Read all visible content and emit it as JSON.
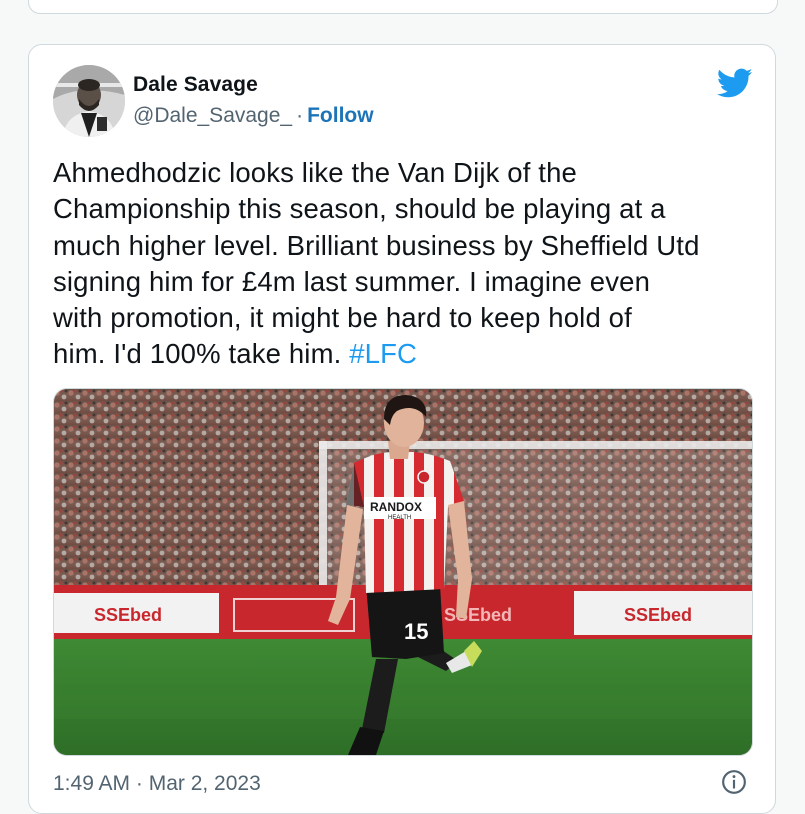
{
  "tweet": {
    "author_name": "Dale Savage",
    "handle": "@Dale_Savage_",
    "separator": "·",
    "follow_label": "Follow",
    "text_lines": [
      "Ahmedhodzic looks like the Van Dijk of the",
      "Championship this season, should be playing at a",
      "much higher level. Brilliant business by Sheffield Utd",
      "signing him for £4m last summer. I imagine even",
      "with promotion, it might be hard to keep hold of",
      "him. I'd 100% take him. "
    ],
    "hashtag": "#LFC",
    "timestamp": "1:49 AM · Mar 2, 2023",
    "photo": {
      "kit_sponsor": "RANDOX",
      "kit_sponsor_sub": "HEALTH",
      "shirt_number": "15",
      "board_text": "SSEbed"
    }
  },
  "icons": {
    "brand": "twitter-bird-icon",
    "info": "info-icon"
  },
  "colors": {
    "link": "#1d73b8",
    "hashtag": "#1d9bf0",
    "twitter_blue": "#1d9bf0",
    "muted": "#536471",
    "border": "#cfd9de",
    "page_bg": "#f7f9f9"
  }
}
